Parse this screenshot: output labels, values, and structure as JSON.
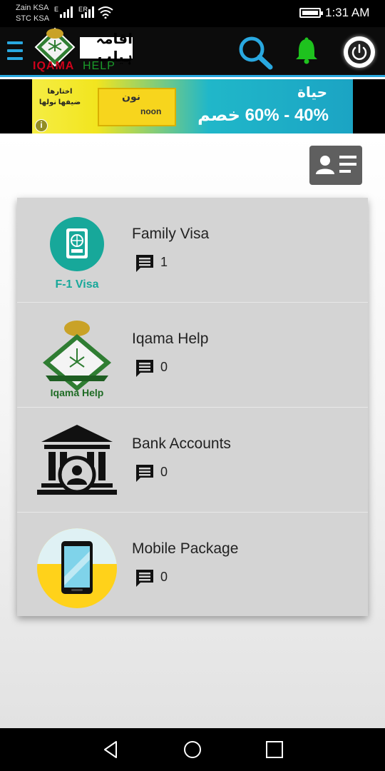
{
  "status_bar": {
    "carrier_1": "Zain KSA",
    "carrier_2": "STC KSA",
    "signal_1_label": "E",
    "signal_2_label": "E R",
    "time": "1:31 AM"
  },
  "header": {
    "logo_urdu": "اقامہ ہیلپ",
    "logo_iqama": "IQAMA",
    "logo_help": "HELP",
    "accent_color": "#29a8e0",
    "icons": [
      "menu-icon",
      "search-icon",
      "bell-icon",
      "power-icon"
    ]
  },
  "ad": {
    "left_text": "اختارها ضيفها نولها",
    "brand_ar": "نون",
    "brand": "noon",
    "headline": "حياة",
    "offer": "40% - 60% خصم",
    "info_label": "i"
  },
  "items": [
    {
      "title": "Family Visa",
      "count": "1",
      "icon": "visa-icon",
      "icon_caption": "F-1 Visa"
    },
    {
      "title": "Iqama Help",
      "count": "0",
      "icon": "iqama-emblem-icon",
      "icon_caption": "Iqama Help"
    },
    {
      "title": "Bank Accounts",
      "count": "0",
      "icon": "bank-icon"
    },
    {
      "title": "Mobile Package",
      "count": "0",
      "icon": "mobile-phone-icon"
    }
  ],
  "nav": {
    "icons": [
      "back-icon",
      "home-icon",
      "recents-icon"
    ]
  }
}
